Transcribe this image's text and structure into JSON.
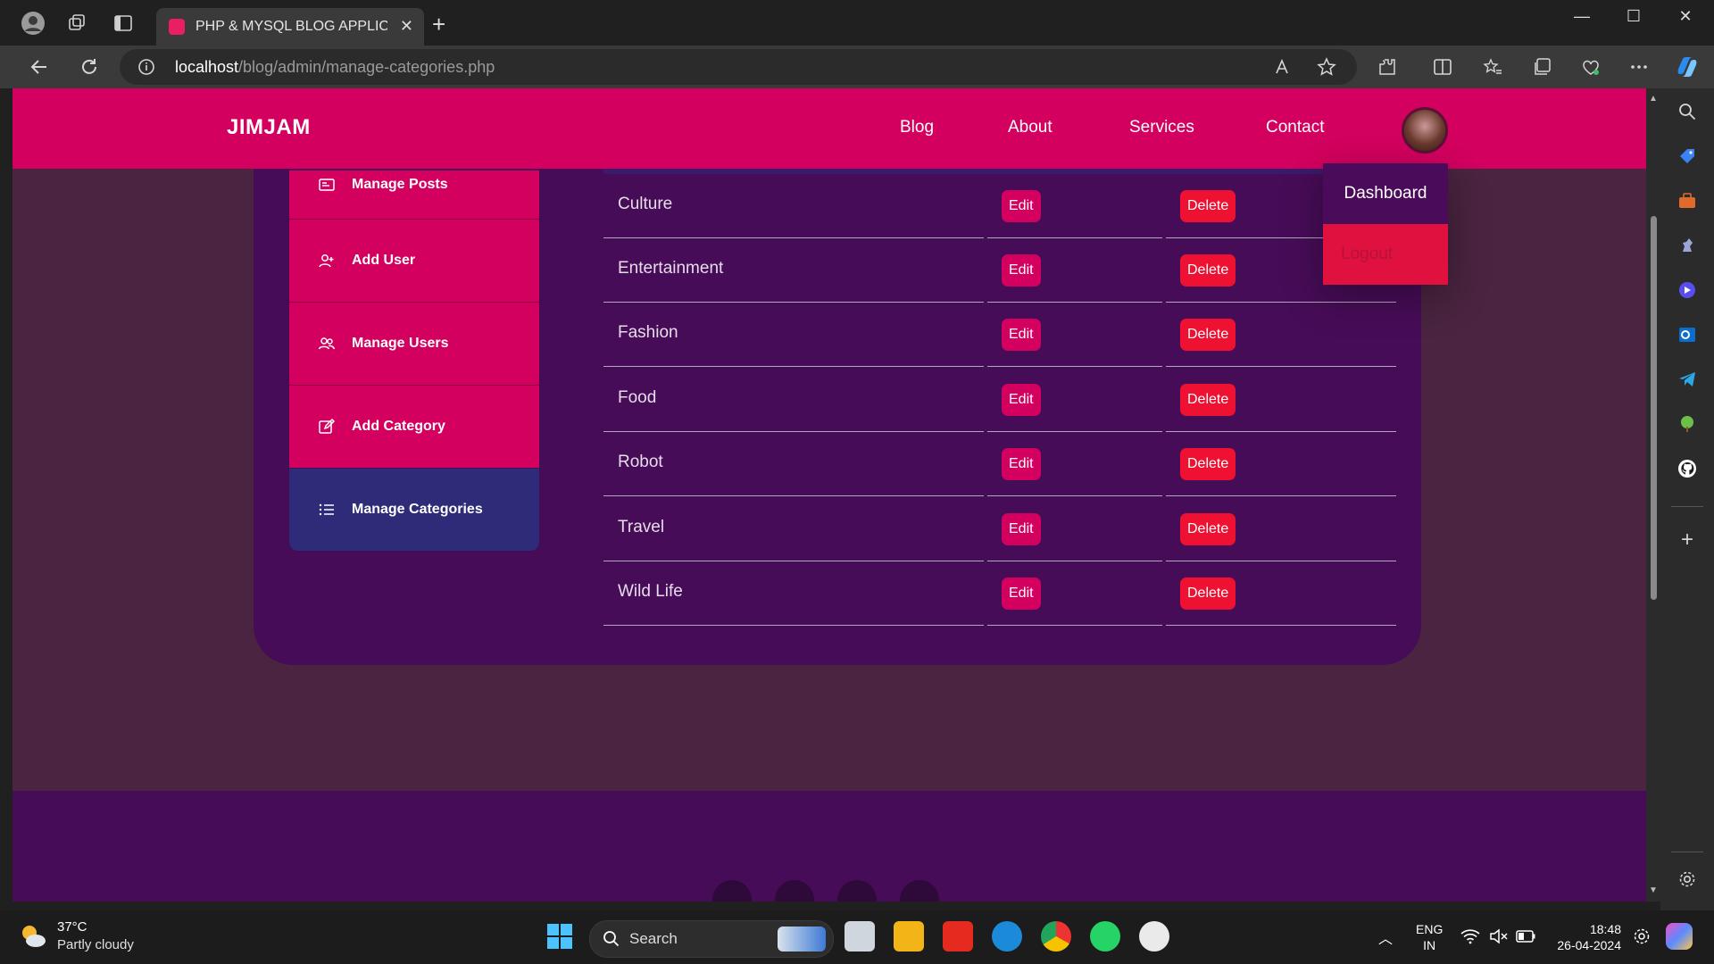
{
  "browser": {
    "tab_title": "PHP & MYSQL BLOG APPLICATIO",
    "url_host": "localhost",
    "url_path": "/blog/admin/manage-categories.php"
  },
  "site": {
    "logo": "JIMJAM",
    "menu": [
      "Blog",
      "About",
      "Services",
      "Contact"
    ],
    "dropdown": {
      "dashboard": "Dashboard",
      "logout": "Logout"
    }
  },
  "admin_sidebar": [
    {
      "label": "Manage Posts",
      "icon": "posts-icon",
      "active": false
    },
    {
      "label": "Add User",
      "icon": "add-user-icon",
      "active": false
    },
    {
      "label": "Manage Users",
      "icon": "users-icon",
      "active": false
    },
    {
      "label": "Add Category",
      "icon": "edit-icon",
      "active": false
    },
    {
      "label": "Manage Categories",
      "icon": "list-icon",
      "active": true
    }
  ],
  "categories": [
    {
      "name": "Culture",
      "edit": "Edit",
      "delete": "Delete"
    },
    {
      "name": "Entertainment",
      "edit": "Edit",
      "delete": "Delete"
    },
    {
      "name": "Fashion",
      "edit": "Edit",
      "delete": "Delete"
    },
    {
      "name": "Food",
      "edit": "Edit",
      "delete": "Delete"
    },
    {
      "name": "Robot",
      "edit": "Edit",
      "delete": "Delete"
    },
    {
      "name": "Travel",
      "edit": "Edit",
      "delete": "Delete"
    },
    {
      "name": "Wild Life",
      "edit": "Edit",
      "delete": "Delete"
    }
  ],
  "taskbar": {
    "weather_temp": "37°C",
    "weather_desc": "Partly cloudy",
    "search": "Search",
    "lang_1": "ENG",
    "lang_2": "IN",
    "time": "18:48",
    "date": "26-04-2024"
  },
  "colors": {
    "brand": "#d3005f",
    "card": "#470c57",
    "active_nav": "#2e2b78",
    "delete": "#ee1132"
  }
}
